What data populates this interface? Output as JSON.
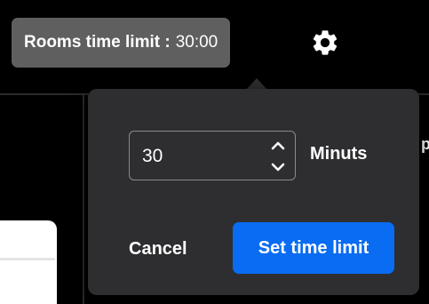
{
  "timer": {
    "label": "Rooms time limit :",
    "value": "30:00"
  },
  "settings": {
    "icon": "gear-icon"
  },
  "popover": {
    "minutes_value": "30",
    "unit_label": "Minuts",
    "cancel_label": "Cancel",
    "submit_label": "Set time limit"
  },
  "background": {
    "partial_text": "p"
  },
  "colors": {
    "pill_bg": "#5f5f5f",
    "popover_bg": "#2e2e30",
    "primary_button": "#0a6cf2",
    "page_bg": "#000000"
  }
}
